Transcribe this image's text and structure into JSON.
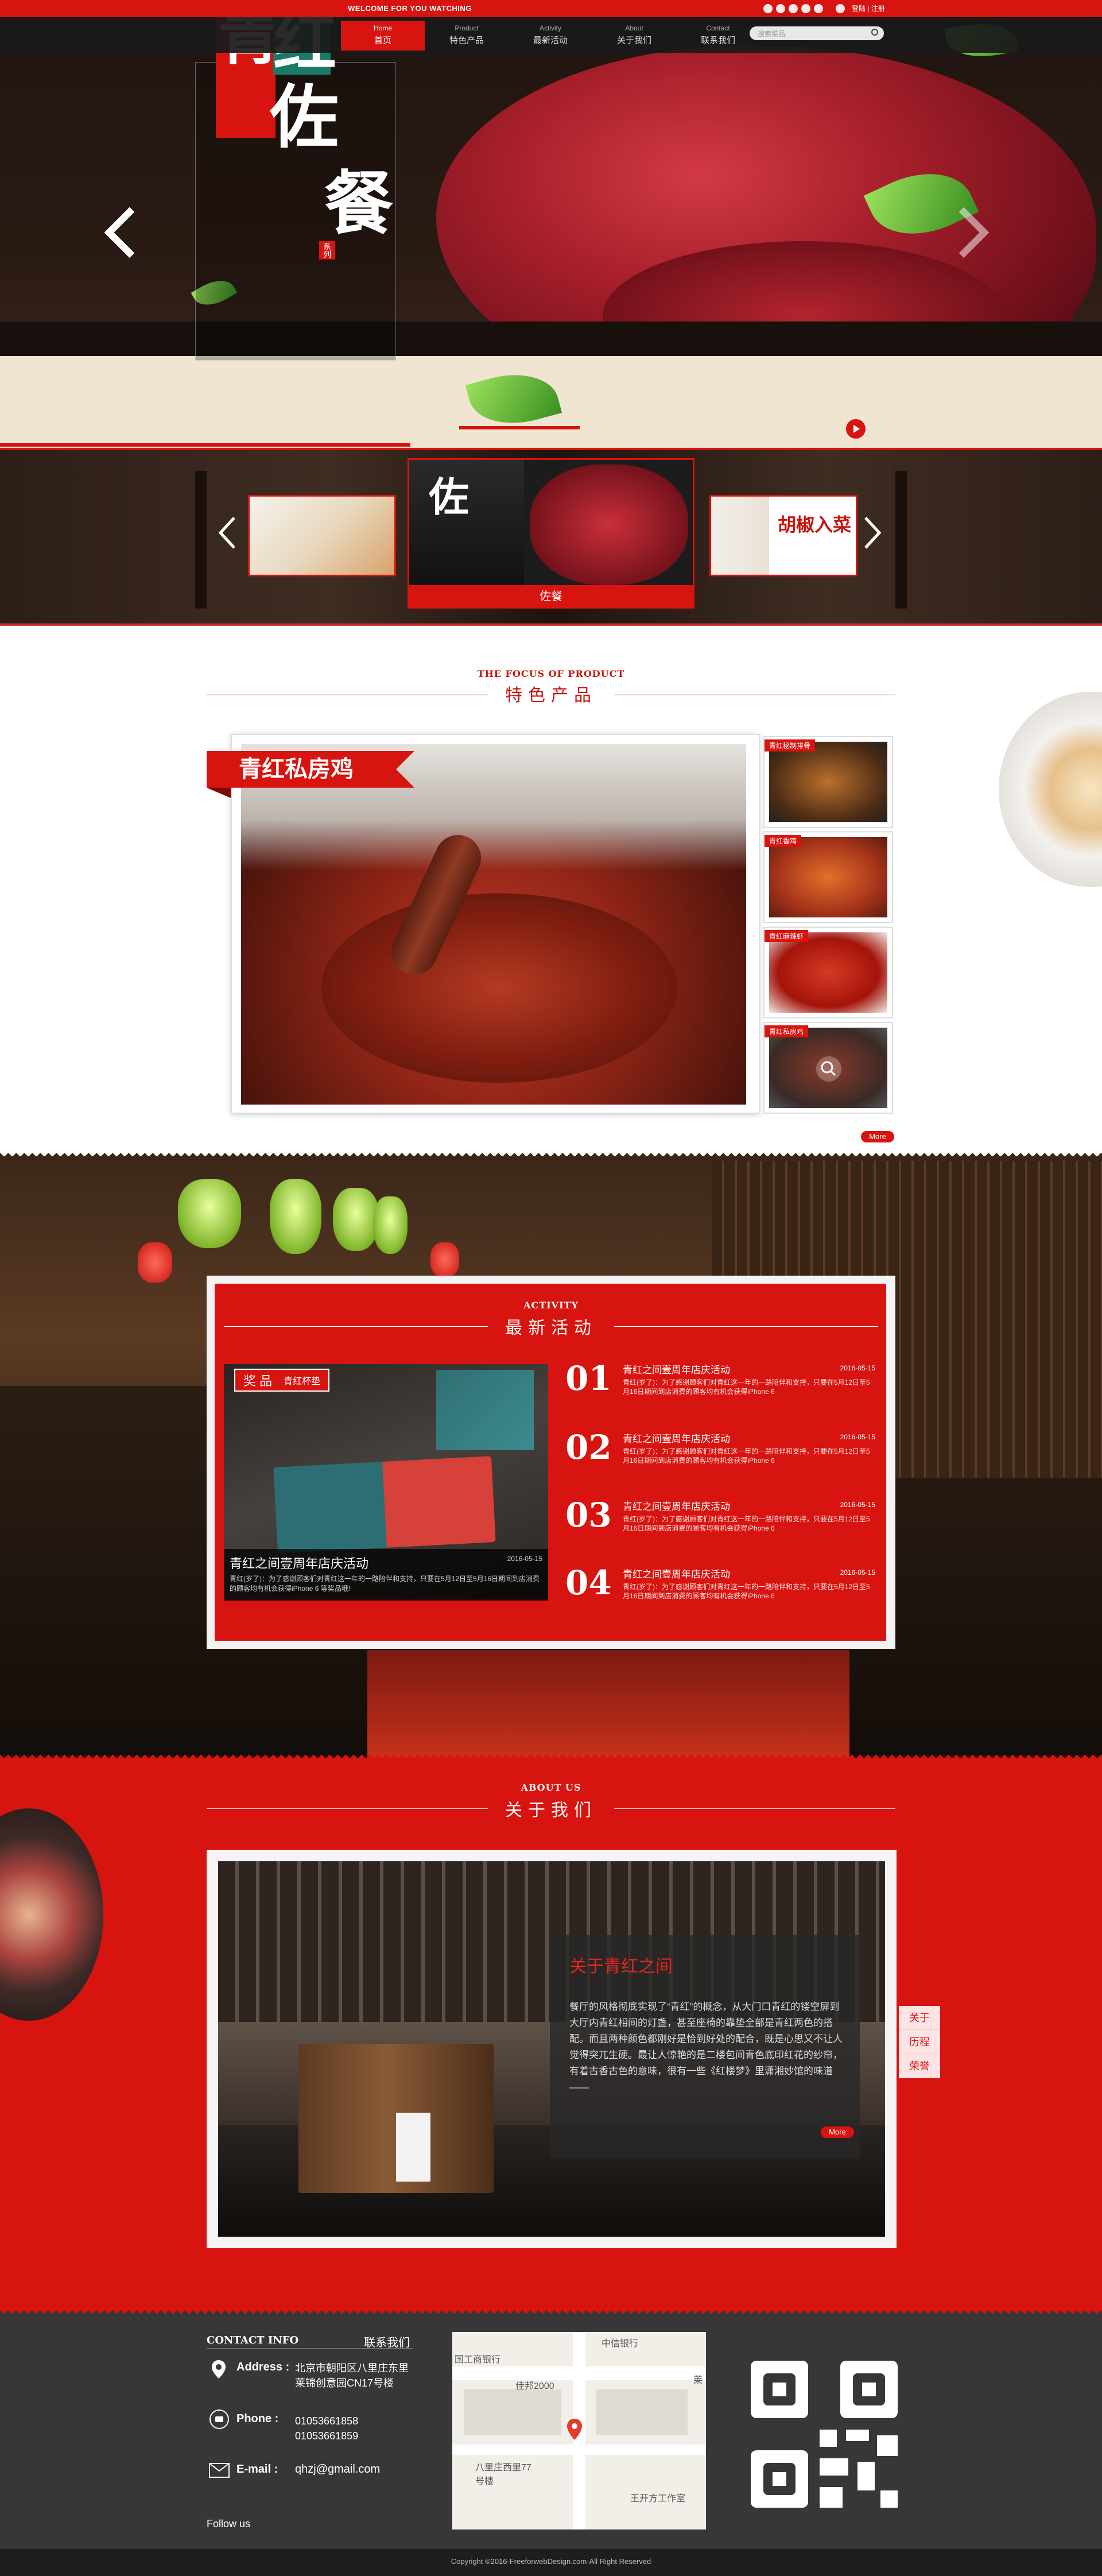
{
  "header": {
    "welcome": "WELCOME FOR YOU WATCHING",
    "nav": [
      {
        "en": "Home",
        "cn": "首页",
        "active": true
      },
      {
        "en": "Product",
        "cn": "特色产品"
      },
      {
        "en": "Activity",
        "cn": "最新活动"
      },
      {
        "en": "About",
        "cn": "关于我们"
      },
      {
        "en": "Contact",
        "cn": "联系我们"
      }
    ],
    "login": "登陆 | 注册",
    "search_placeholder": "搜索菜品"
  },
  "hero": {
    "logo_chars": [
      "青",
      "红",
      "佐",
      "餐"
    ],
    "logo_small": "系列"
  },
  "strip": {
    "caption": "佐餐",
    "thumb_right_text": "胡椒入菜"
  },
  "products": {
    "section_en": "THE FOCUS OF PRODUCT",
    "section_cn": "特色产品",
    "featured": "青红私房鸡",
    "side_labels": [
      "青红秘制排骨",
      "青红香鸡",
      "青红麻辣虾",
      "青红私房鸡"
    ],
    "more": "More"
  },
  "activity": {
    "section_en": "ACTIVITY",
    "section_cn": "最新活动",
    "badge": "奖 品",
    "badge_sub": "青红杯垫",
    "photo_caption": "青红之间壹周年店庆活动",
    "photo_desc": "青红(岁了)：为了感谢顾客们对青红这一年的一路陪伴和支持，只要在5月12日至5月16日期间到店消费的顾客均有机会获得iPhone 6 等奖品哦!",
    "photo_date": "2016-05-15",
    "items": [
      {
        "num": "01",
        "title": "青红之间壹周年店庆活动",
        "date": "2016-05-15",
        "desc": "青红(岁了)：为了感谢顾客们对青红这一年的一路陪伴和支持，只要在5月12日至5月16日期间到店消费的顾客均有机会获得iPhone 6"
      },
      {
        "num": "02",
        "title": "青红之间壹周年店庆活动",
        "date": "2016-05-15",
        "desc": "青红(岁了)：为了感谢顾客们对青红这一年的一路陪伴和支持，只要在5月12日至5月16日期间到店消费的顾客均有机会获得iPhone 6"
      },
      {
        "num": "03",
        "title": "青红之间壹周年店庆活动",
        "date": "2016-05-15",
        "desc": "青红(岁了)：为了感谢顾客们对青红这一年的一路陪伴和支持，只要在5月12日至5月16日期间到店消费的顾客均有机会获得iPhone 6"
      },
      {
        "num": "04",
        "title": "青红之间壹周年店庆活动",
        "date": "2016-05-15",
        "desc": "青红(岁了)：为了感谢顾客们对青红这一年的一路陪伴和支持，只要在5月12日至5月16日期间到店消费的顾客均有机会获得iPhone 6"
      }
    ]
  },
  "about": {
    "section_en": "ABOUT US",
    "section_cn": "关于我们",
    "title": "关于青红之间",
    "text": "餐厅的风格彻底实现了“青红”的概念，从大门口青红的镂空屏到大厅内青红相间的灯盏，甚至座椅的靠垫全部是青红两色的搭配。而且两种颜色都刚好是恰到好处的配合，既是心思又不让人觉得突兀生硬。最让人惊艳的是二楼包间青色底印红花的纱帘，有着古香古色的意味，很有一些《红楼梦》里潇湘妙馆的味道——",
    "more": "More",
    "tabs": [
      "关于",
      "历程",
      "荣誉"
    ]
  },
  "footer": {
    "contact_en": "CONTACT INFO",
    "contact_cn": "联系我们",
    "address_label": "Address :",
    "address": [
      "北京市朝阳区八里庄东里",
      "莱锦创意园CN17号楼"
    ],
    "phone_label": "Phone :",
    "phones": [
      "01053661858",
      "01053661859"
    ],
    "email_label": "E-mail :",
    "email": "qhzj@gmail.com",
    "follow": "Follow us",
    "map_labels": [
      "中信银行",
      "国工商银行",
      "佳邦2000",
      "八里庄西里77号楼",
      "王开方工作室",
      "莱"
    ],
    "copyright": "Copyright ©2016-FreeforwebDesign.com-All Right Reserved"
  }
}
